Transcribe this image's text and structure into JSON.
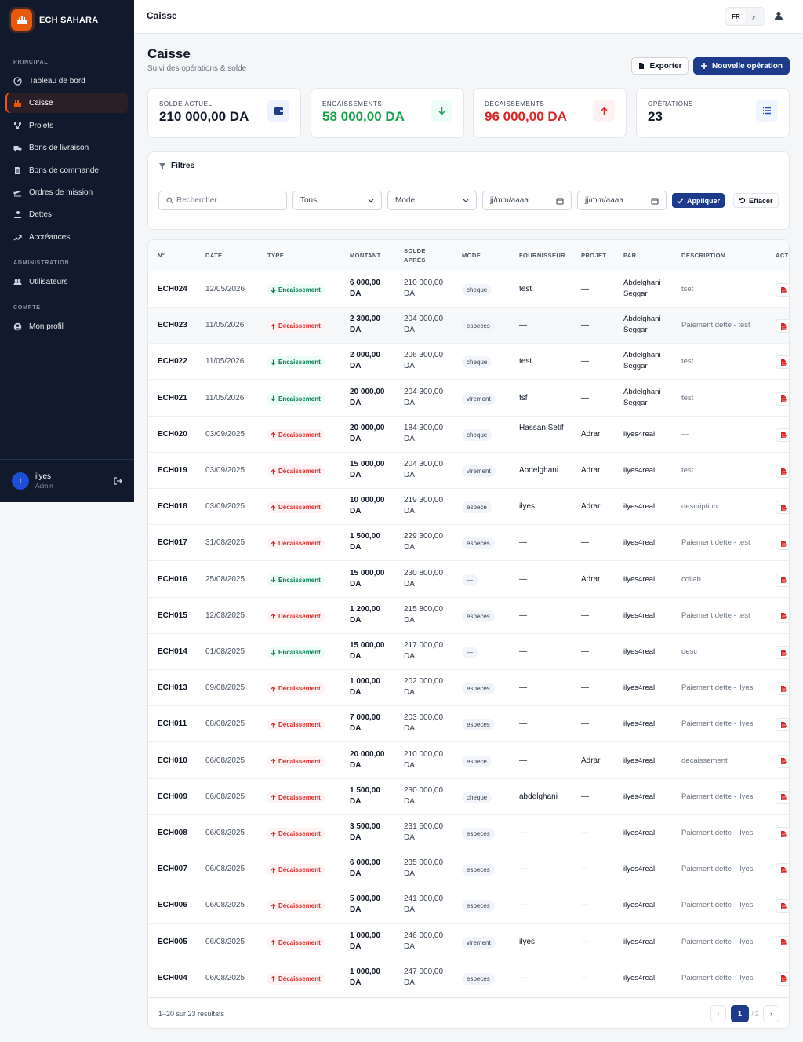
{
  "brand": {
    "name": "ECH SAHARA"
  },
  "sidebar": {
    "sections": {
      "principal": "PRINCIPAL",
      "administration": "ADMINISTRATION",
      "compte": "COMPTE"
    },
    "items": [
      {
        "label": "Tableau de bord",
        "icon": "dashboard-icon"
      },
      {
        "label": "Caisse",
        "icon": "cash-register-icon"
      },
      {
        "label": "Projets",
        "icon": "projects-icon"
      },
      {
        "label": "Bons de livraison",
        "icon": "truck-icon"
      },
      {
        "label": "Bons de commande",
        "icon": "document-icon"
      },
      {
        "label": "Ordres de mission",
        "icon": "plane-icon"
      },
      {
        "label": "Dettes",
        "icon": "hand-coins-icon"
      },
      {
        "label": "Accréances",
        "icon": "trend-icon"
      },
      {
        "label": "Utilisateurs",
        "icon": "users-icon"
      },
      {
        "label": "Mon profil",
        "icon": "user-circle-icon"
      }
    ],
    "user": {
      "initial": "I",
      "name": "ilyes",
      "role": "Admin"
    }
  },
  "topbar": {
    "title": "Caisse",
    "lang_fr": "FR",
    "lang_ar": "ع"
  },
  "page": {
    "title": "Caisse",
    "subtitle": "Suivi des opérations & solde",
    "export_label": "Exporter",
    "new_label": "Nouvelle opération"
  },
  "stats": [
    {
      "label": "SOLDE ACTUEL",
      "value": "210 000,00 DA",
      "color": "#111827"
    },
    {
      "label": "ENCAISSEMENTS",
      "value": "58 000,00 DA",
      "color": "#16a34a"
    },
    {
      "label": "DÉCAISSEMENTS",
      "value": "96 000,00 DA",
      "color": "#dc2626"
    },
    {
      "label": "OPÉRATIONS",
      "value": "23",
      "color": "#111827"
    }
  ],
  "filters": {
    "title": "Filtres",
    "search_placeholder": "Rechercher...",
    "type_value": "Tous",
    "mode_value": "Mode",
    "date_from": "jj/mm/aaaa",
    "date_to": "jj/mm/aaaa",
    "apply_label": "Appliquer",
    "clear_label": "Effacer"
  },
  "table": {
    "headers": {
      "num": "N°",
      "date": "DATE",
      "type": "TYPE",
      "montant": "MONTANT",
      "solde": "SOLDE APRÈS",
      "mode": "MODE",
      "fournisseur": "FOURNISSEUR",
      "projet": "PROJET",
      "par": "PAR",
      "description": "DESCRIPTION",
      "actions": "ACTIONS"
    },
    "rows": [
      {
        "num": "ECH024",
        "date": "12/05/2026",
        "type": "in",
        "type_label": "Encaissement",
        "amount": "6 000,00",
        "amount_unit": "DA",
        "solde": "210 000,00",
        "solde_unit": "DA",
        "mode": "cheque",
        "fournisseur": "test",
        "projet": "—",
        "par": "Abdelghani Seggar",
        "desc": "tset"
      },
      {
        "num": "ECH023",
        "date": "11/05/2026",
        "type": "out",
        "type_label": "Décaissement",
        "amount": "2 300,00",
        "amount_unit": "DA",
        "solde": "204 000,00",
        "solde_unit": "DA",
        "mode": "especes",
        "fournisseur": "—",
        "projet": "—",
        "par": "Abdelghani Seggar",
        "desc": "Paiement dette - test"
      },
      {
        "num": "ECH022",
        "date": "11/05/2026",
        "type": "in",
        "type_label": "Encaissement",
        "amount": "2 000,00",
        "amount_unit": "DA",
        "solde": "206 300,00",
        "solde_unit": "DA",
        "mode": "cheque",
        "fournisseur": "test",
        "projet": "—",
        "par": "Abdelghani Seggar",
        "desc": "test"
      },
      {
        "num": "ECH021",
        "date": "11/05/2026",
        "type": "in",
        "type_label": "Encaissement",
        "amount": "20 000,00",
        "amount_unit": "DA",
        "solde": "204 300,00",
        "solde_unit": "DA",
        "mode": "virement",
        "fournisseur": "fsf",
        "projet": "—",
        "par": "Abdelghani Seggar",
        "desc": "test"
      },
      {
        "num": "ECH020",
        "date": "03/09/2025",
        "type": "out",
        "type_label": "Décaissement",
        "amount": "20 000,00",
        "amount_unit": "DA",
        "solde": "184 300,00",
        "solde_unit": "DA",
        "mode": "cheque",
        "fournisseur": "Hassan Setif",
        "projet": "Adrar",
        "par": "ilyes4real",
        "desc": "—"
      },
      {
        "num": "ECH019",
        "date": "03/09/2025",
        "type": "out",
        "type_label": "Décaissement",
        "amount": "15 000,00",
        "amount_unit": "DA",
        "solde": "204 300,00",
        "solde_unit": "DA",
        "mode": "virement",
        "fournisseur": "Abdelghani",
        "projet": "Adrar",
        "par": "ilyes4real",
        "desc": "test"
      },
      {
        "num": "ECH018",
        "date": "03/09/2025",
        "type": "out",
        "type_label": "Décaissement",
        "amount": "10 000,00",
        "amount_unit": "DA",
        "solde": "219 300,00",
        "solde_unit": "DA",
        "mode": "espece",
        "fournisseur": "ilyes",
        "projet": "Adrar",
        "par": "ilyes4real",
        "desc": "description"
      },
      {
        "num": "ECH017",
        "date": "31/08/2025",
        "type": "out",
        "type_label": "Décaissement",
        "amount": "1 500,00",
        "amount_unit": "DA",
        "solde": "229 300,00",
        "solde_unit": "DA",
        "mode": "especes",
        "fournisseur": "—",
        "projet": "—",
        "par": "ilyes4real",
        "desc": "Paiement dette - test"
      },
      {
        "num": "ECH016",
        "date": "25/08/2025",
        "type": "in",
        "type_label": "Encaissement",
        "amount": "15 000,00",
        "amount_unit": "DA",
        "solde": "230 800,00",
        "solde_unit": "DA",
        "mode": "—",
        "fournisseur": "—",
        "projet": "Adrar",
        "par": "ilyes4real",
        "desc": "collab"
      },
      {
        "num": "ECH015",
        "date": "12/08/2025",
        "type": "out",
        "type_label": "Décaissement",
        "amount": "1 200,00",
        "amount_unit": "DA",
        "solde": "215 800,00",
        "solde_unit": "DA",
        "mode": "especes",
        "fournisseur": "—",
        "projet": "—",
        "par": "ilyes4real",
        "desc": "Paiement dette - test"
      },
      {
        "num": "ECH014",
        "date": "01/08/2025",
        "type": "in",
        "type_label": "Encaissement",
        "amount": "15 000,00",
        "amount_unit": "DA",
        "solde": "217 000,00",
        "solde_unit": "DA",
        "mode": "—",
        "fournisseur": "—",
        "projet": "—",
        "par": "ilyes4real",
        "desc": "desc"
      },
      {
        "num": "ECH013",
        "date": "09/08/2025",
        "type": "out",
        "type_label": "Décaissement",
        "amount": "1 000,00",
        "amount_unit": "DA",
        "solde": "202 000,00",
        "solde_unit": "DA",
        "mode": "especes",
        "fournisseur": "—",
        "projet": "—",
        "par": "ilyes4real",
        "desc": "Paiement dette - ilyes"
      },
      {
        "num": "ECH011",
        "date": "08/08/2025",
        "type": "out",
        "type_label": "Décaissement",
        "amount": "7 000,00",
        "amount_unit": "DA",
        "solde": "203 000,00",
        "solde_unit": "DA",
        "mode": "especes",
        "fournisseur": "—",
        "projet": "—",
        "par": "ilyes4real",
        "desc": "Paiement dette - ilyes"
      },
      {
        "num": "ECH010",
        "date": "06/08/2025",
        "type": "out",
        "type_label": "Décaissement",
        "amount": "20 000,00",
        "amount_unit": "DA",
        "solde": "210 000,00",
        "solde_unit": "DA",
        "mode": "espece",
        "fournisseur": "—",
        "projet": "Adrar",
        "par": "ilyes4real",
        "desc": "decaissement"
      },
      {
        "num": "ECH009",
        "date": "06/08/2025",
        "type": "out",
        "type_label": "Décaissement",
        "amount": "1 500,00",
        "amount_unit": "DA",
        "solde": "230 000,00",
        "solde_unit": "DA",
        "mode": "cheque",
        "fournisseur": "abdelghani",
        "projet": "—",
        "par": "ilyes4real",
        "desc": "Paiement dette - ilyes"
      },
      {
        "num": "ECH008",
        "date": "06/08/2025",
        "type": "out",
        "type_label": "Décaissement",
        "amount": "3 500,00",
        "amount_unit": "DA",
        "solde": "231 500,00",
        "solde_unit": "DA",
        "mode": "especes",
        "fournisseur": "—",
        "projet": "—",
        "par": "ilyes4real",
        "desc": "Paiement dette - ilyes"
      },
      {
        "num": "ECH007",
        "date": "06/08/2025",
        "type": "out",
        "type_label": "Décaissement",
        "amount": "6 000,00",
        "amount_unit": "DA",
        "solde": "235 000,00",
        "solde_unit": "DA",
        "mode": "especes",
        "fournisseur": "—",
        "projet": "—",
        "par": "ilyes4real",
        "desc": "Paiement dette - ilyes"
      },
      {
        "num": "ECH006",
        "date": "06/08/2025",
        "type": "out",
        "type_label": "Décaissement",
        "amount": "5 000,00",
        "amount_unit": "DA",
        "solde": "241 000,00",
        "solde_unit": "DA",
        "mode": "especes",
        "fournisseur": "—",
        "projet": "—",
        "par": "ilyes4real",
        "desc": "Paiement dette - ilyes"
      },
      {
        "num": "ECH005",
        "date": "06/08/2025",
        "type": "out",
        "type_label": "Décaissement",
        "amount": "1 000,00",
        "amount_unit": "DA",
        "solde": "246 000,00",
        "solde_unit": "DA",
        "mode": "virement",
        "fournisseur": "ilyes",
        "projet": "—",
        "par": "ilyes4real",
        "desc": "Paiement dette - ilyes"
      },
      {
        "num": "ECH004",
        "date": "06/08/2025",
        "type": "out",
        "type_label": "Décaissement",
        "amount": "1 000,00",
        "amount_unit": "DA",
        "solde": "247 000,00",
        "solde_unit": "DA",
        "mode": "especes",
        "fournisseur": "—",
        "projet": "—",
        "par": "ilyes4real",
        "desc": "Paiement dette - ilyes"
      }
    ]
  },
  "pagination": {
    "summary": "1–20 sur 23 résultats",
    "current": "1",
    "total": "/ 2",
    "prev": "‹",
    "next": "›"
  }
}
